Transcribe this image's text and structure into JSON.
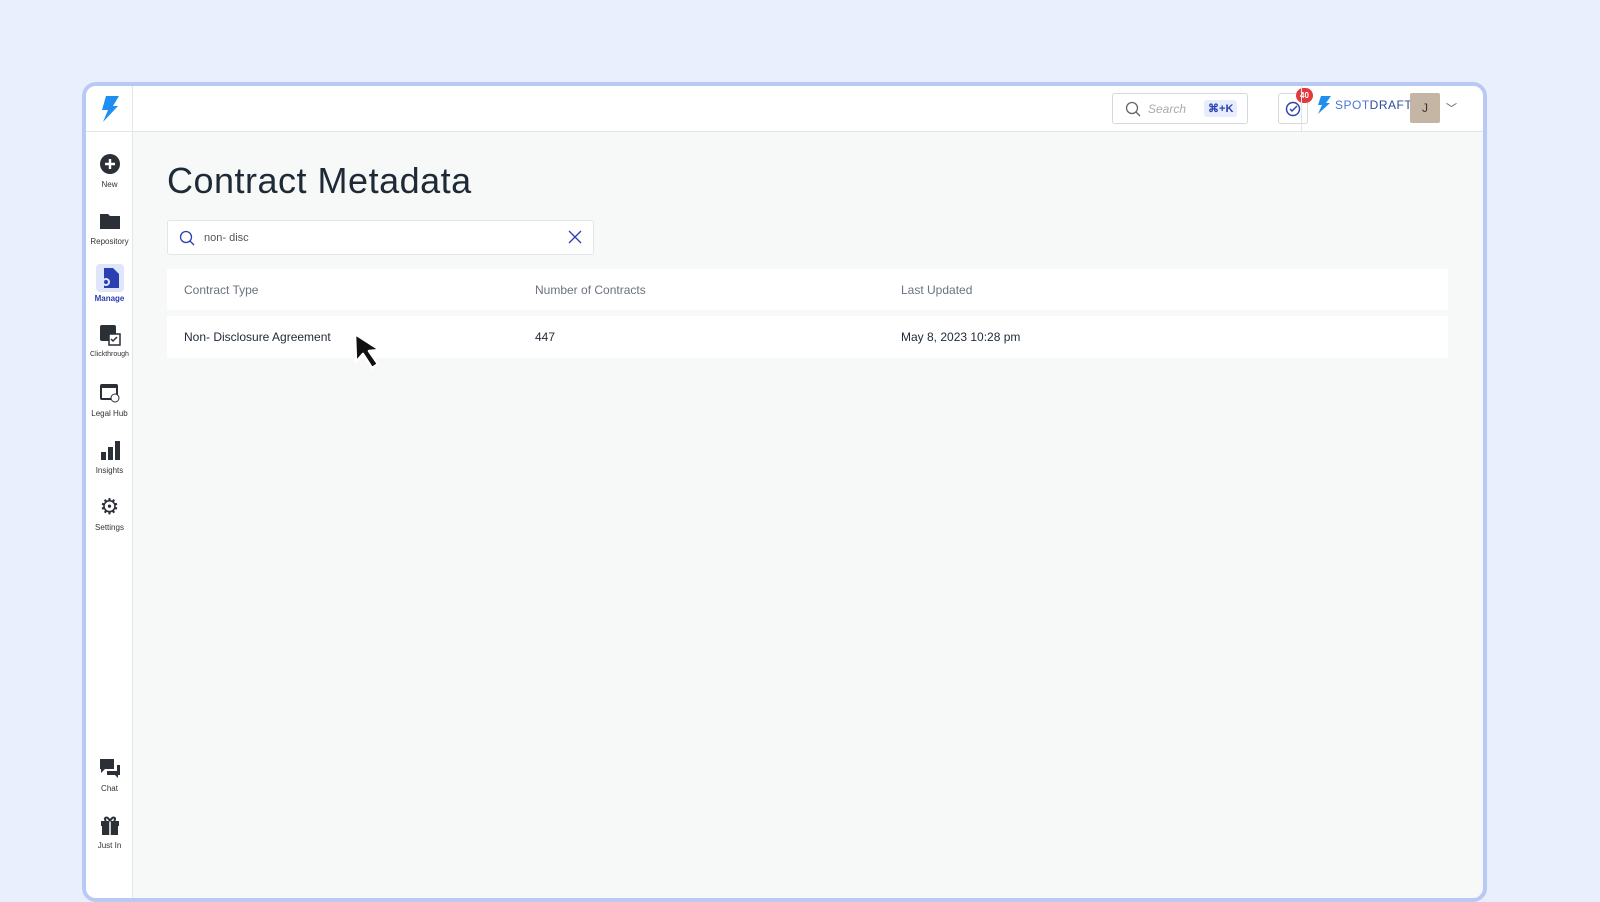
{
  "sidebar": {
    "items": [
      {
        "label": "New"
      },
      {
        "label": "Repository"
      },
      {
        "label": "Manage"
      },
      {
        "label": "Clickthrough"
      },
      {
        "label": "Legal Hub"
      },
      {
        "label": "Insights"
      },
      {
        "label": "Settings"
      },
      {
        "label": "Chat"
      },
      {
        "label": "Just In"
      }
    ]
  },
  "header": {
    "search_placeholder": "Search",
    "shortcut": "⌘+K",
    "notification_count": "40",
    "brand_a": "SPOT",
    "brand_b": "DRAFT",
    "avatar_initial": "J"
  },
  "main": {
    "title": "Contract Metadata",
    "filter_value": "non- disc",
    "columns": [
      "Contract Type",
      "Number of Contracts",
      "Last Updated"
    ],
    "rows": [
      {
        "type": "Non- Disclosure Agreement",
        "count": "447",
        "updated": "May 8, 2023 10:28 pm"
      }
    ]
  }
}
